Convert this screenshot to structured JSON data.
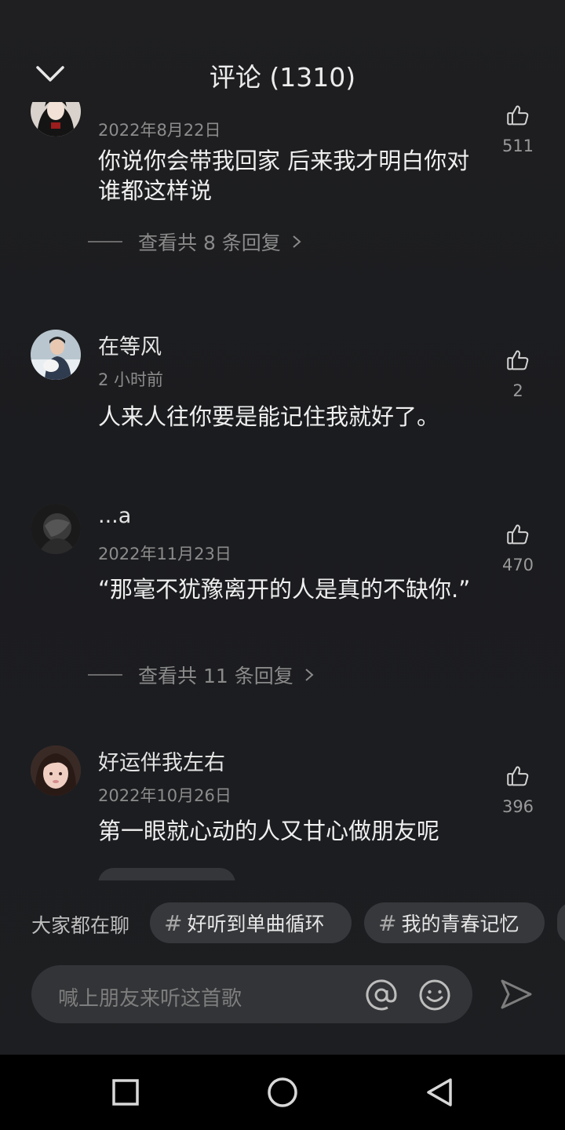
{
  "header": {
    "title": "评论 (1310)"
  },
  "comments": [
    {
      "username": "",
      "time": "2022年8月22日",
      "text": "你说你会带我回家 后来我才明白你对谁都这样说",
      "likes": "511",
      "replies": "查看共 8 条回复"
    },
    {
      "username": "在等风",
      "time": "2 小时前",
      "text": "人来人往你要是能记住我就好了。",
      "likes": "2"
    },
    {
      "username": "...a",
      "time": "2022年11月23日",
      "text": "“那毫不犹豫离开的人是真的不缺你.”",
      "likes": "470",
      "replies": "查看共 11 条回复"
    },
    {
      "username": "好运伴我左右",
      "time": "2022年10月26日",
      "text": "第一眼就心动的人又甘心做朋友呢",
      "likes": "396"
    }
  ],
  "topics": {
    "lead": "大家都在聊",
    "chips": [
      {
        "hash": "#",
        "text": "好听到单曲循环"
      },
      {
        "hash": "#",
        "text": "我的青春记忆"
      }
    ]
  },
  "composer": {
    "placeholder": "喊上朋友来听这首歌"
  },
  "icons": {
    "back": "chevron-down-icon",
    "like": "thumbs-up-icon",
    "at": "at-icon",
    "emoji": "emoji-icon",
    "send": "send-icon",
    "nav": [
      "square-recents-icon",
      "circle-home-icon",
      "triangle-back-icon"
    ]
  },
  "colors": {
    "background": "#1d1e21",
    "chip": "#37383b",
    "navbar": "#000000"
  }
}
